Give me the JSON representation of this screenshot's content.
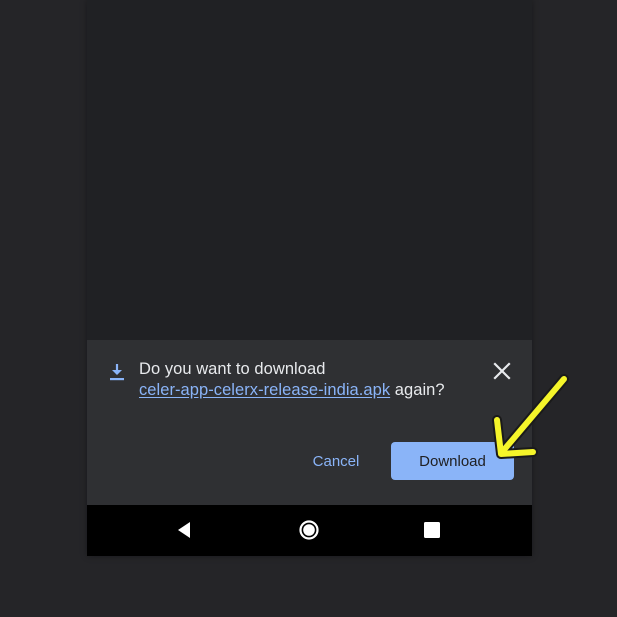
{
  "download_prompt": {
    "message_prefix": "Do you want to download",
    "file_name": "celer-app-celerx-release-india.apk",
    "message_suffix": " again?",
    "cancel_label": "Cancel",
    "confirm_label": "Download",
    "icons": {
      "download": "download-icon",
      "close": "close-icon"
    }
  },
  "nav_bar": {
    "icons": [
      "back-icon",
      "home-icon",
      "recents-icon"
    ]
  },
  "colors": {
    "accent": "#8ab4f8",
    "sheet_background": "#2f3033",
    "page_background": "#202124",
    "annotation": "#f5f52a"
  }
}
